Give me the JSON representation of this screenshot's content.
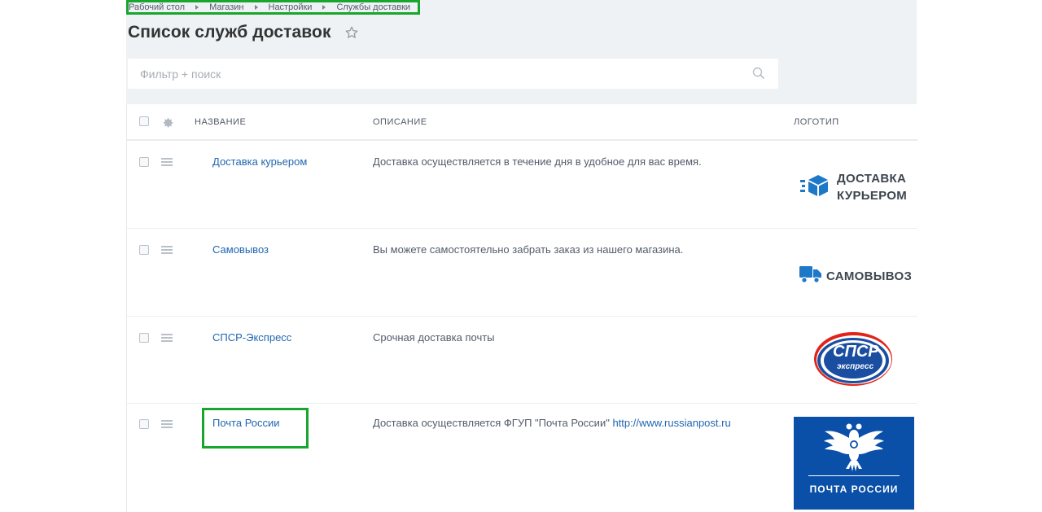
{
  "breadcrumb": [
    "Рабочий стол",
    "Магазин",
    "Настройки",
    "Службы доставки"
  ],
  "page": {
    "title": "Список служб доставок"
  },
  "filter": {
    "placeholder": "Фильтр + поиск"
  },
  "table": {
    "columns": {
      "name": "НАЗВАНИЕ",
      "description": "ОПИСАНИЕ",
      "logo": "ЛОГОТИП"
    },
    "rows": [
      {
        "name": "Доставка курьером",
        "description": "Доставка осуществляется в течение дня в удобное для вас время.",
        "logo": {
          "icon": "box-icon",
          "line1": "ДОСТАВКА",
          "line2": "КУРЬЕРОМ"
        }
      },
      {
        "name": "Самовывоз",
        "description": "Вы можете самостоятельно забрать заказ из нашего магазина.",
        "logo": {
          "icon": "truck-icon",
          "line1": "САМОВЫВОЗ"
        }
      },
      {
        "name": "СПСР-Экспресс",
        "description": "Срочная доставка почты",
        "logo": {
          "line1": "СПСР",
          "line2": "экспресс"
        }
      },
      {
        "name": "Почта России",
        "description": "Доставка осуществляется ФГУП \"Почта России\"",
        "description_link": "http://www.russianpost.ru",
        "logo": {
          "line1": "ПОЧТА РОССИИ"
        }
      }
    ]
  },
  "colors": {
    "accent": "#2067b0",
    "highlight": "#1aa52e",
    "header_bg": "#eef2f4",
    "post_blue": "#0a4fa8"
  }
}
